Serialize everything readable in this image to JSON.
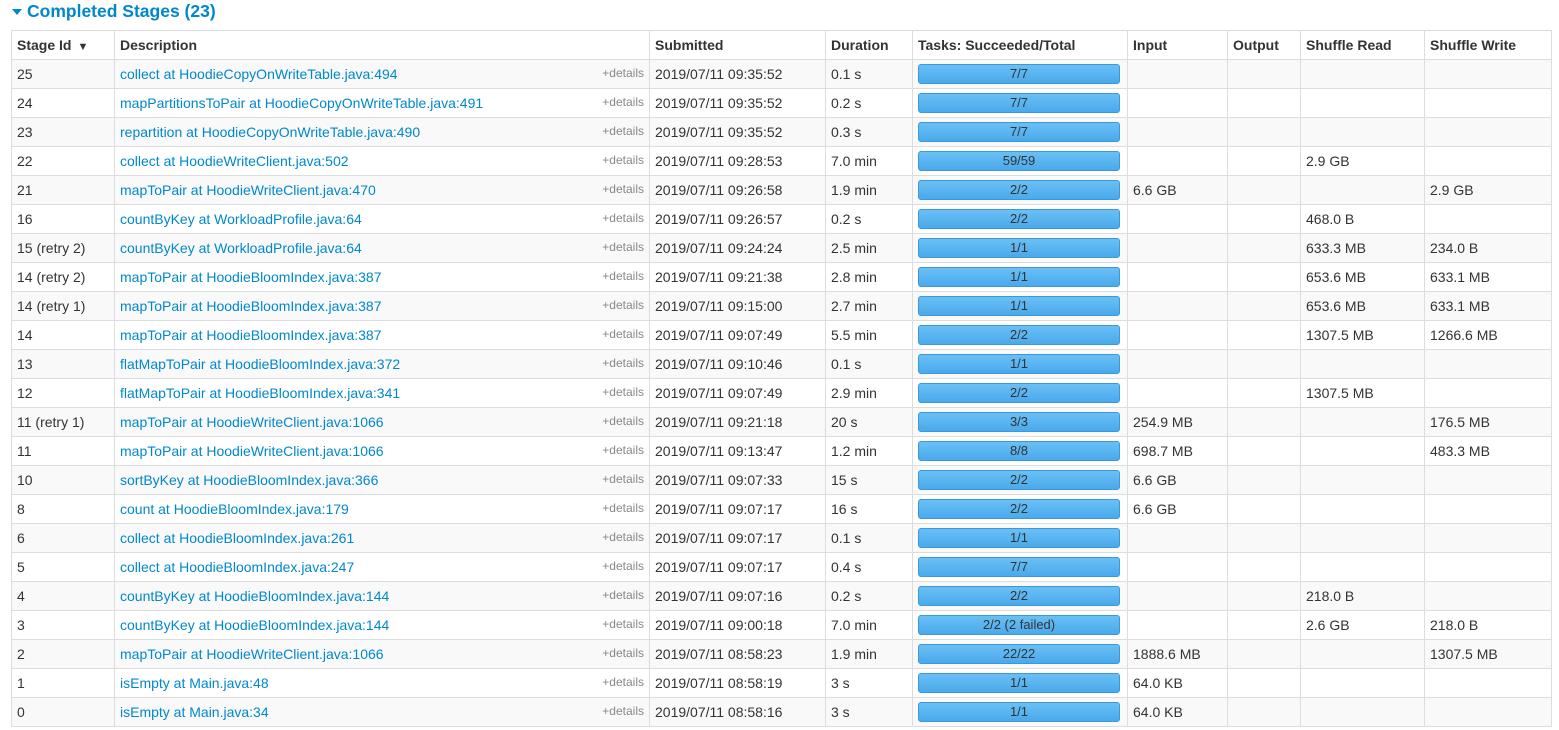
{
  "header": {
    "title": "Completed Stages (23)"
  },
  "table": {
    "columns": [
      "Stage Id",
      "Description",
      "Submitted",
      "Duration",
      "Tasks: Succeeded/Total",
      "Input",
      "Output",
      "Shuffle Read",
      "Shuffle Write"
    ],
    "sort_indicator": "▼",
    "details_label": "+details",
    "rows": [
      {
        "id": "25",
        "desc": "collect at HoodieCopyOnWriteTable.java:494",
        "submitted": "2019/07/11 09:35:52",
        "duration": "0.1 s",
        "tasks": "7/7",
        "progress": 1,
        "input": "",
        "output": "",
        "shuffle_read": "",
        "shuffle_write": ""
      },
      {
        "id": "24",
        "desc": "mapPartitionsToPair at HoodieCopyOnWriteTable.java:491",
        "submitted": "2019/07/11 09:35:52",
        "duration": "0.2 s",
        "tasks": "7/7",
        "progress": 1,
        "input": "",
        "output": "",
        "shuffle_read": "",
        "shuffle_write": ""
      },
      {
        "id": "23",
        "desc": "repartition at HoodieCopyOnWriteTable.java:490",
        "submitted": "2019/07/11 09:35:52",
        "duration": "0.3 s",
        "tasks": "7/7",
        "progress": 1,
        "input": "",
        "output": "",
        "shuffle_read": "",
        "shuffle_write": ""
      },
      {
        "id": "22",
        "desc": "collect at HoodieWriteClient.java:502",
        "submitted": "2019/07/11 09:28:53",
        "duration": "7.0 min",
        "tasks": "59/59",
        "progress": 1,
        "input": "",
        "output": "",
        "shuffle_read": "2.9 GB",
        "shuffle_write": ""
      },
      {
        "id": "21",
        "desc": "mapToPair at HoodieWriteClient.java:470",
        "submitted": "2019/07/11 09:26:58",
        "duration": "1.9 min",
        "tasks": "2/2",
        "progress": 1,
        "input": "6.6 GB",
        "output": "",
        "shuffle_read": "",
        "shuffle_write": "2.9 GB"
      },
      {
        "id": "16",
        "desc": "countByKey at WorkloadProfile.java:64",
        "submitted": "2019/07/11 09:26:57",
        "duration": "0.2 s",
        "tasks": "2/2",
        "progress": 1,
        "input": "",
        "output": "",
        "shuffle_read": "468.0 B",
        "shuffle_write": ""
      },
      {
        "id": "15 (retry 2)",
        "desc": "countByKey at WorkloadProfile.java:64",
        "submitted": "2019/07/11 09:24:24",
        "duration": "2.5 min",
        "tasks": "1/1",
        "progress": 1,
        "input": "",
        "output": "",
        "shuffle_read": "633.3 MB",
        "shuffle_write": "234.0 B"
      },
      {
        "id": "14 (retry 2)",
        "desc": "mapToPair at HoodieBloomIndex.java:387",
        "submitted": "2019/07/11 09:21:38",
        "duration": "2.8 min",
        "tasks": "1/1",
        "progress": 1,
        "input": "",
        "output": "",
        "shuffle_read": "653.6 MB",
        "shuffle_write": "633.1 MB"
      },
      {
        "id": "14 (retry 1)",
        "desc": "mapToPair at HoodieBloomIndex.java:387",
        "submitted": "2019/07/11 09:15:00",
        "duration": "2.7 min",
        "tasks": "1/1",
        "progress": 1,
        "input": "",
        "output": "",
        "shuffle_read": "653.6 MB",
        "shuffle_write": "633.1 MB"
      },
      {
        "id": "14",
        "desc": "mapToPair at HoodieBloomIndex.java:387",
        "submitted": "2019/07/11 09:07:49",
        "duration": "5.5 min",
        "tasks": "2/2",
        "progress": 1,
        "input": "",
        "output": "",
        "shuffle_read": "1307.5 MB",
        "shuffle_write": "1266.6 MB"
      },
      {
        "id": "13",
        "desc": "flatMapToPair at HoodieBloomIndex.java:372",
        "submitted": "2019/07/11 09:10:46",
        "duration": "0.1 s",
        "tasks": "1/1",
        "progress": 1,
        "input": "",
        "output": "",
        "shuffle_read": "",
        "shuffle_write": ""
      },
      {
        "id": "12",
        "desc": "flatMapToPair at HoodieBloomIndex.java:341",
        "submitted": "2019/07/11 09:07:49",
        "duration": "2.9 min",
        "tasks": "2/2",
        "progress": 1,
        "input": "",
        "output": "",
        "shuffle_read": "1307.5 MB",
        "shuffle_write": ""
      },
      {
        "id": "11 (retry 1)",
        "desc": "mapToPair at HoodieWriteClient.java:1066",
        "submitted": "2019/07/11 09:21:18",
        "duration": "20 s",
        "tasks": "3/3",
        "progress": 1,
        "input": "254.9 MB",
        "output": "",
        "shuffle_read": "",
        "shuffle_write": "176.5 MB"
      },
      {
        "id": "11",
        "desc": "mapToPair at HoodieWriteClient.java:1066",
        "submitted": "2019/07/11 09:13:47",
        "duration": "1.2 min",
        "tasks": "8/8",
        "progress": 1,
        "input": "698.7 MB",
        "output": "",
        "shuffle_read": "",
        "shuffle_write": "483.3 MB"
      },
      {
        "id": "10",
        "desc": "sortByKey at HoodieBloomIndex.java:366",
        "submitted": "2019/07/11 09:07:33",
        "duration": "15 s",
        "tasks": "2/2",
        "progress": 1,
        "input": "6.6 GB",
        "output": "",
        "shuffle_read": "",
        "shuffle_write": ""
      },
      {
        "id": "8",
        "desc": "count at HoodieBloomIndex.java:179",
        "submitted": "2019/07/11 09:07:17",
        "duration": "16 s",
        "tasks": "2/2",
        "progress": 1,
        "input": "6.6 GB",
        "output": "",
        "shuffle_read": "",
        "shuffle_write": ""
      },
      {
        "id": "6",
        "desc": "collect at HoodieBloomIndex.java:261",
        "submitted": "2019/07/11 09:07:17",
        "duration": "0.1 s",
        "tasks": "1/1",
        "progress": 1,
        "input": "",
        "output": "",
        "shuffle_read": "",
        "shuffle_write": ""
      },
      {
        "id": "5",
        "desc": "collect at HoodieBloomIndex.java:247",
        "submitted": "2019/07/11 09:07:17",
        "duration": "0.4 s",
        "tasks": "7/7",
        "progress": 1,
        "input": "",
        "output": "",
        "shuffle_read": "",
        "shuffle_write": ""
      },
      {
        "id": "4",
        "desc": "countByKey at HoodieBloomIndex.java:144",
        "submitted": "2019/07/11 09:07:16",
        "duration": "0.2 s",
        "tasks": "2/2",
        "progress": 1,
        "input": "",
        "output": "",
        "shuffle_read": "218.0 B",
        "shuffle_write": ""
      },
      {
        "id": "3",
        "desc": "countByKey at HoodieBloomIndex.java:144",
        "submitted": "2019/07/11 09:00:18",
        "duration": "7.0 min",
        "tasks": "2/2 (2 failed)",
        "progress": 1,
        "input": "",
        "output": "",
        "shuffle_read": "2.6 GB",
        "shuffle_write": "218.0 B"
      },
      {
        "id": "2",
        "desc": "mapToPair at HoodieWriteClient.java:1066",
        "submitted": "2019/07/11 08:58:23",
        "duration": "1.9 min",
        "tasks": "22/22",
        "progress": 1,
        "input": "1888.6 MB",
        "output": "",
        "shuffle_read": "",
        "shuffle_write": "1307.5 MB"
      },
      {
        "id": "1",
        "desc": "isEmpty at Main.java:48",
        "submitted": "2019/07/11 08:58:19",
        "duration": "3 s",
        "tasks": "1/1",
        "progress": 1,
        "input": "64.0 KB",
        "output": "",
        "shuffle_read": "",
        "shuffle_write": ""
      },
      {
        "id": "0",
        "desc": "isEmpty at Main.java:34",
        "submitted": "2019/07/11 08:58:16",
        "duration": "3 s",
        "tasks": "1/1",
        "progress": 1,
        "input": "64.0 KB",
        "output": "",
        "shuffle_read": "",
        "shuffle_write": ""
      }
    ]
  }
}
